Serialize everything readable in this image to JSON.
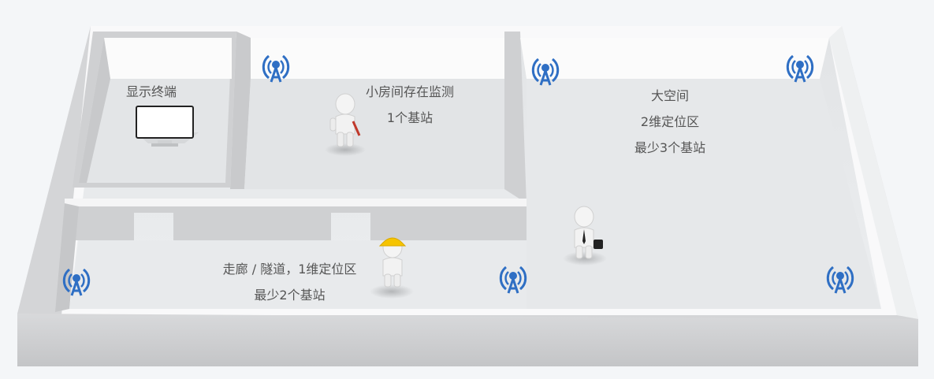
{
  "labels": {
    "display_terminal": "显示终端",
    "small_room_line1": "小房间存在监测",
    "small_room_line2": "1个基站",
    "large_space_line1": "大空间",
    "large_space_line2": "2维定位区",
    "large_space_line3": "最少3个基站",
    "corridor_line1": "走廊 / 隧道，1维定位区",
    "corridor_line2": "最少2个基站"
  },
  "colors": {
    "beacon_blue": "#2f6fc4",
    "floor": "#e6e8ea",
    "wall_top": "#ffffff",
    "wall_side": "#c9cbcd",
    "hardhat": "#f6c400",
    "text": "#555555"
  },
  "icons": [
    "wireless-beacon-icon",
    "person-figure-icon",
    "monitor-icon"
  ]
}
